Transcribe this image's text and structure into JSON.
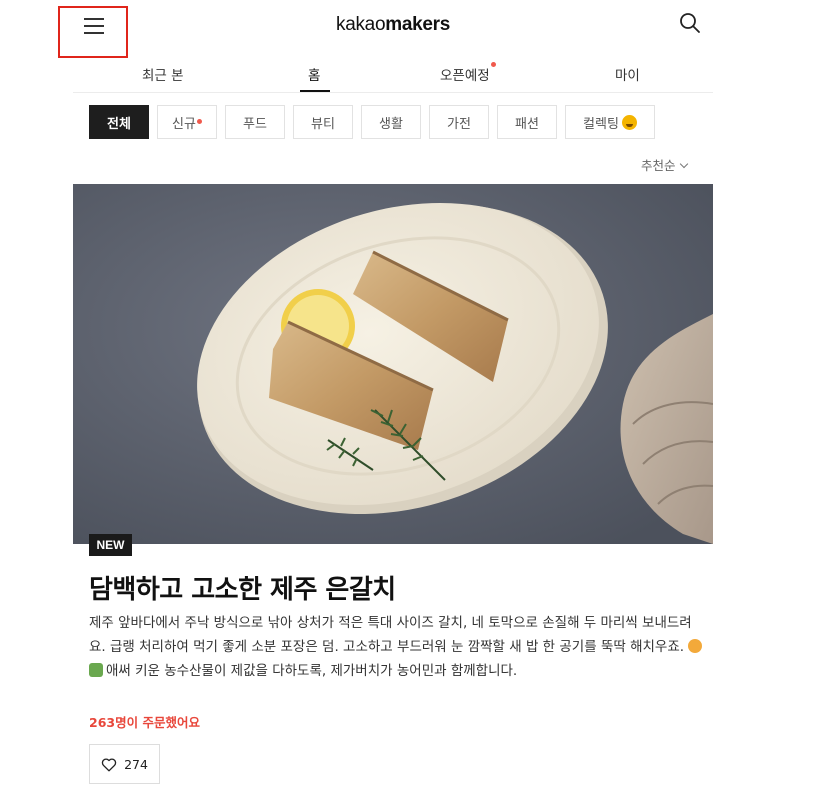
{
  "header": {
    "logo_part1": "kakao",
    "logo_part2": "makers",
    "menu_icon": "hamburger-menu-icon",
    "search_icon": "search-icon"
  },
  "tabs": [
    {
      "label": "최근 본",
      "active": false,
      "dot": false
    },
    {
      "label": "홈",
      "active": true,
      "dot": false
    },
    {
      "label": "오픈예정",
      "active": false,
      "dot": true
    },
    {
      "label": "마이",
      "active": false,
      "dot": false
    }
  ],
  "categories": [
    {
      "label": "전체",
      "active": true
    },
    {
      "label": "신규",
      "dot": true
    },
    {
      "label": "푸드"
    },
    {
      "label": "뷰티"
    },
    {
      "label": "생활"
    },
    {
      "label": "가전"
    },
    {
      "label": "패션"
    },
    {
      "label": "컬렉팅",
      "emoji": "smiling-face-emoji"
    }
  ],
  "sort": {
    "label": "추천순"
  },
  "product": {
    "badge": "NEW",
    "title": "담백하고 고소한 제주 은갈치",
    "description_part1": "제주 앞바다에서 주낙 방식으로 낚아 상처가 적은 특대 사이즈 갈치, 네 토막으로 손질해 두 마리씩 보내드려요. 급랭 처리하여 먹기 좋게 소분 포장은 덤. 고소하고 부드러워 눈 깜짝할 새 밥 한 공기를 뚝딱 해치우죠.",
    "description_part2": "애써 키운 농수산물이 제값을 다하도록, 제가버치가 농어민과 함께합니다.",
    "farmer_icon": "farmer-emoji",
    "corn_icon": "corn-emoji",
    "ordered_text": "263명이 주문했어요",
    "likes": "274",
    "like_icon": "heart-outline-icon"
  },
  "colors": {
    "accent_red": "#e8473b",
    "dot_red": "#f0594c",
    "dark": "#1e1e1e",
    "highlight_box": "#e0251b"
  }
}
